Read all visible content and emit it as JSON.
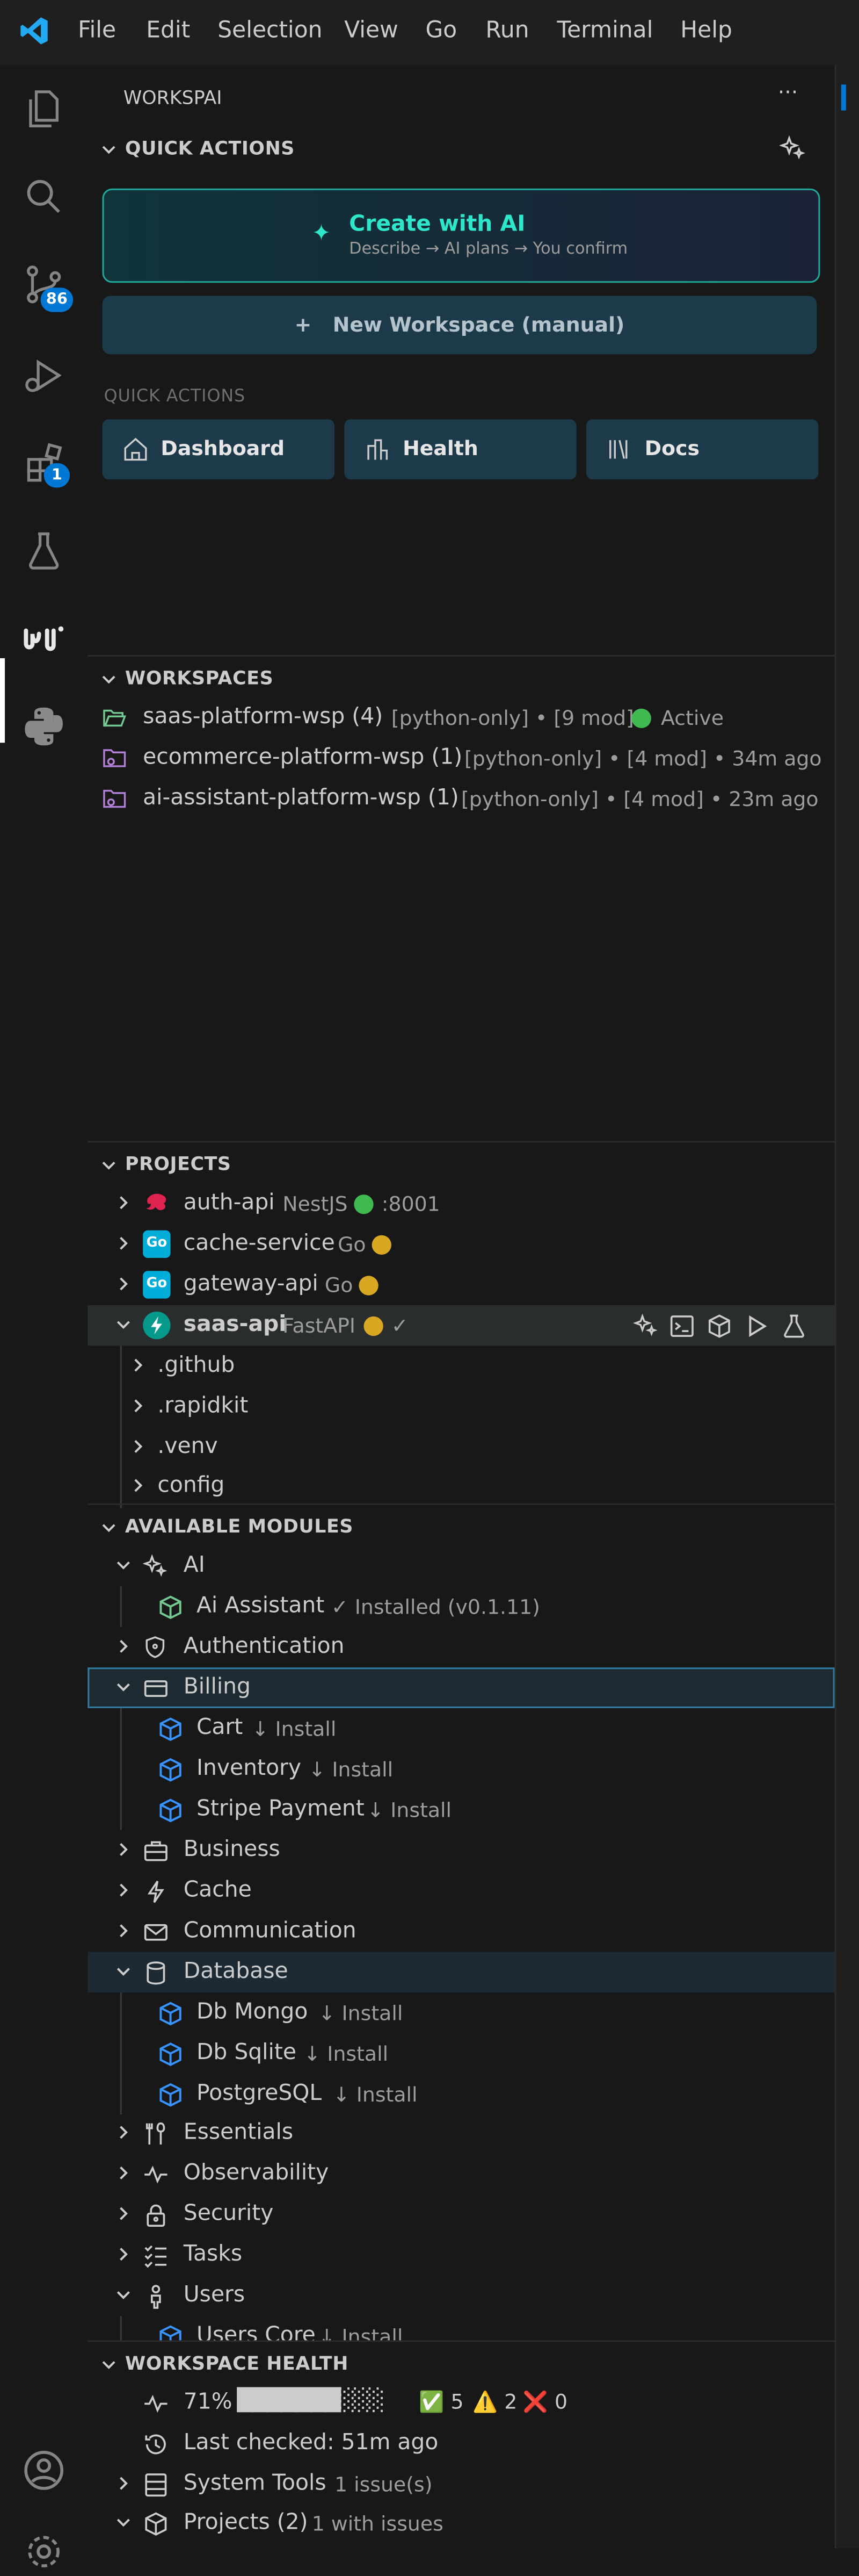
{
  "menubar": {
    "items": [
      "File",
      "Edit",
      "Selection",
      "View",
      "Go",
      "Run",
      "Terminal",
      "Help"
    ]
  },
  "activity_bar": {
    "scm_badge": "86",
    "extensions_badge": "1"
  },
  "sidebar": {
    "title": "WORKSPAI",
    "more": "···"
  },
  "quick_actions": {
    "header": "QUICK ACTIONS",
    "create_ai": {
      "icon": "✦",
      "title": "Create with AI",
      "subtitle": "Describe → AI plans → You confirm"
    },
    "new_workspace": "+   New Workspace (manual)",
    "subheader": "QUICK ACTIONS",
    "buttons": [
      "Dashboard",
      "Health",
      "Docs"
    ]
  },
  "workspaces": {
    "header": "WORKSPACES",
    "items": [
      {
        "name": "saas-platform-wsp (4)",
        "meta": "[python-only] • [9 mod] •",
        "status": "Active"
      },
      {
        "name": "ecommerce-platform-wsp (1)",
        "meta": "[python-only] • [4 mod] • 34m ago"
      },
      {
        "name": "ai-assistant-platform-wsp (1)",
        "meta": "[python-only] • [4 mod] • 23m ago"
      }
    ]
  },
  "projects": {
    "header": "PROJECTS",
    "items": [
      {
        "name": "auth-api",
        "meta": "NestJS",
        "extra": ":8001"
      },
      {
        "name": "cache-service",
        "meta": "Go"
      },
      {
        "name": "gateway-api",
        "meta": "Go"
      },
      {
        "name": "saas-api",
        "meta": "FastAPI",
        "extra": "✓"
      }
    ],
    "folders": [
      ".github",
      ".rapidkit",
      ".venv",
      "config"
    ]
  },
  "modules": {
    "header": "AVAILABLE MODULES",
    "ai": "AI",
    "ai_assistant": "Ai Assistant",
    "ai_assistant_status": "✓ Installed (v0.1.11)",
    "authentication": "Authentication",
    "billing": "Billing",
    "billing_items": [
      {
        "name": "Cart",
        "action": "↓ Install"
      },
      {
        "name": "Inventory",
        "action": "↓ Install"
      },
      {
        "name": "Stripe Payment",
        "action": "↓ Install"
      }
    ],
    "business": "Business",
    "cache": "Cache",
    "communication": "Communication",
    "database": "Database",
    "database_items": [
      {
        "name": "Db Mongo",
        "action": "↓ Install"
      },
      {
        "name": "Db Sqlite",
        "action": "↓ Install"
      },
      {
        "name": "PostgreSQL",
        "action": "↓ Install"
      }
    ],
    "essentials": "Essentials",
    "observability": "Observability",
    "security": "Security",
    "tasks": "Tasks",
    "users": "Users",
    "users_items": [
      {
        "name": "Users Core",
        "action": "↓ Install"
      }
    ]
  },
  "health": {
    "header": "WORKSPACE HEALTH",
    "percent": "71%",
    "bar": "███████░░░",
    "ok": "✅ 5",
    "warn": "⚠️ 2",
    "err": "❌ 0",
    "last_checked": "Last checked: 51m ago",
    "system_tools": "System Tools",
    "system_tools_meta": "1 issue(s)",
    "projects": "Projects (2)",
    "projects_meta": "1 with issues"
  },
  "colors": {
    "accent": "#0078d4",
    "ai_border": "#1ea79a",
    "button_bg": "#1d3a4a",
    "active_green": "#3fb950",
    "warn_yellow": "#d8a822",
    "folder_green": "#73c991",
    "folder_purple": "#b180d7",
    "module_blue": "#3794ff"
  }
}
